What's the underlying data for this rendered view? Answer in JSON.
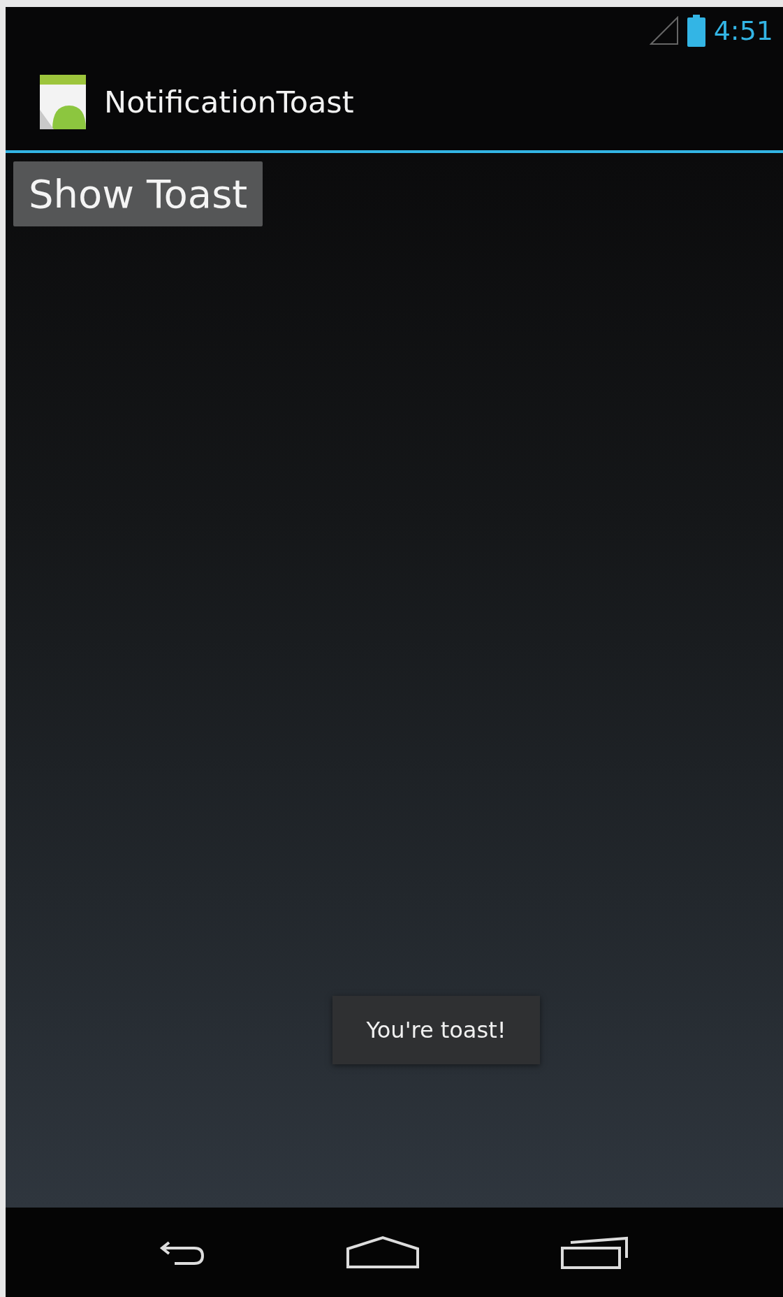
{
  "status_bar": {
    "time": "4:51"
  },
  "action_bar": {
    "title": "NotificationToast"
  },
  "content": {
    "button": {
      "label": "Show Toast"
    }
  },
  "toast": {
    "text": "You're toast!"
  }
}
